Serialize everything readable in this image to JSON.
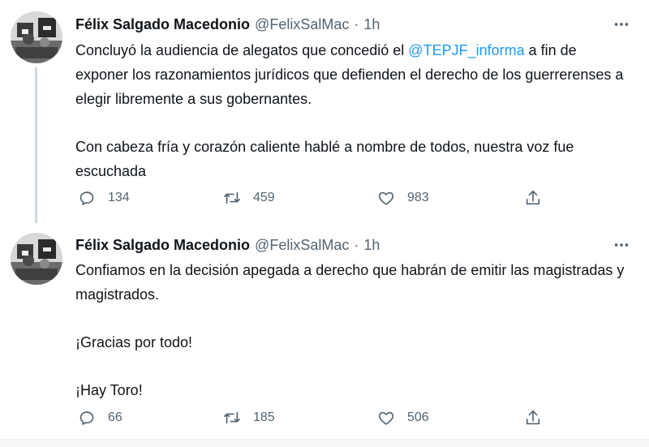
{
  "tweets": [
    {
      "author_name": "Félix Salgado Macedonio",
      "handle": "@FelixSalMac",
      "separator": "·",
      "time": "1h",
      "text_before_mention": "Concluyó la audiencia de alegatos que concedió el ",
      "mention": "@TEPJF_informa",
      "text_after_mention": " a fin de exponer los razonamientos jurídicos que defienden el derecho de los guerrerenses a elegir libremente a sus gobernantes.",
      "paragraph_2": "Con cabeza fría y corazón caliente hablé a nombre de todos, nuestra voz fue escuchada",
      "replies": "134",
      "retweets": "459",
      "likes": "983",
      "icons": {
        "more": "more-horizontal-icon",
        "reply": "reply-icon",
        "retweet": "retweet-icon",
        "like": "heart-icon",
        "share": "share-icon"
      }
    },
    {
      "author_name": "Félix Salgado Macedonio",
      "handle": "@FelixSalMac",
      "separator": "·",
      "time": "1h",
      "paragraph_1": "Confiamos en la decisión apegada a derecho que habrán de emitir las magistradas y magistrados.",
      "paragraph_2": "¡Gracias por todo!",
      "paragraph_3": "¡Hay Toro!",
      "replies": "66",
      "retweets": "185",
      "likes": "506",
      "icons": {
        "more": "more-horizontal-icon",
        "reply": "reply-icon",
        "retweet": "retweet-icon",
        "like": "heart-icon",
        "share": "share-icon"
      }
    }
  ],
  "colors": {
    "text": "#0f1419",
    "secondary": "#536471",
    "mention": "#1d9bf0",
    "thread_line": "#cfd9de"
  }
}
